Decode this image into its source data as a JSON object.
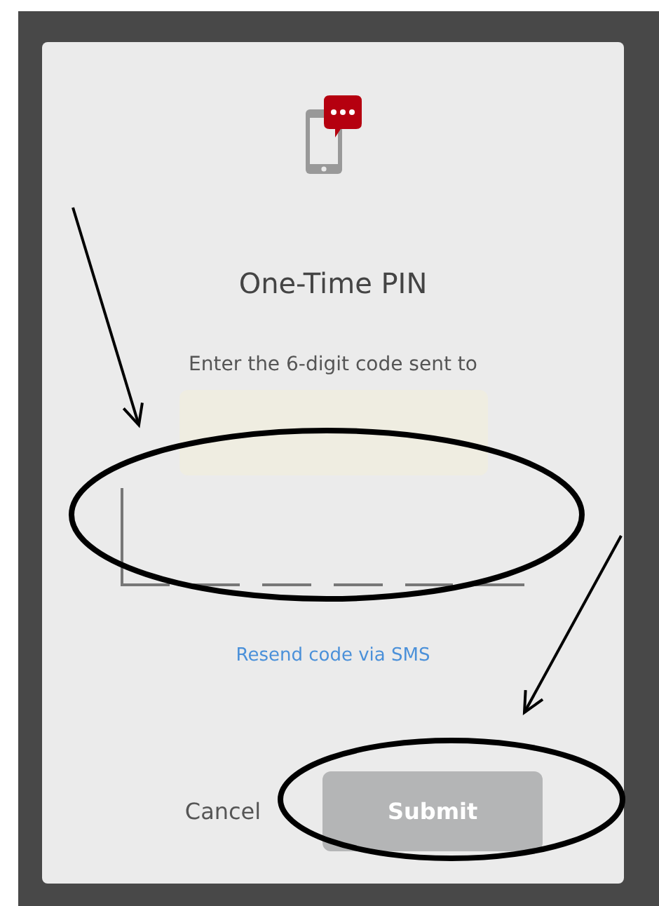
{
  "dialog": {
    "title": "One-Time PIN",
    "instruction": "Enter the 6-digit code sent to",
    "otp": {
      "focused": true
    },
    "resend_link": "Resend code via SMS",
    "buttons": [
      {
        "label": "Cancel",
        "kind": "text",
        "disabled": false
      },
      {
        "label": "Submit",
        "kind": "primary",
        "disabled": true
      }
    ]
  },
  "annotations": [
    {
      "kind": "arrow"
    },
    {
      "kind": "ellipse"
    },
    {
      "kind": "arrow"
    },
    {
      "kind": "ellipse"
    }
  ]
}
